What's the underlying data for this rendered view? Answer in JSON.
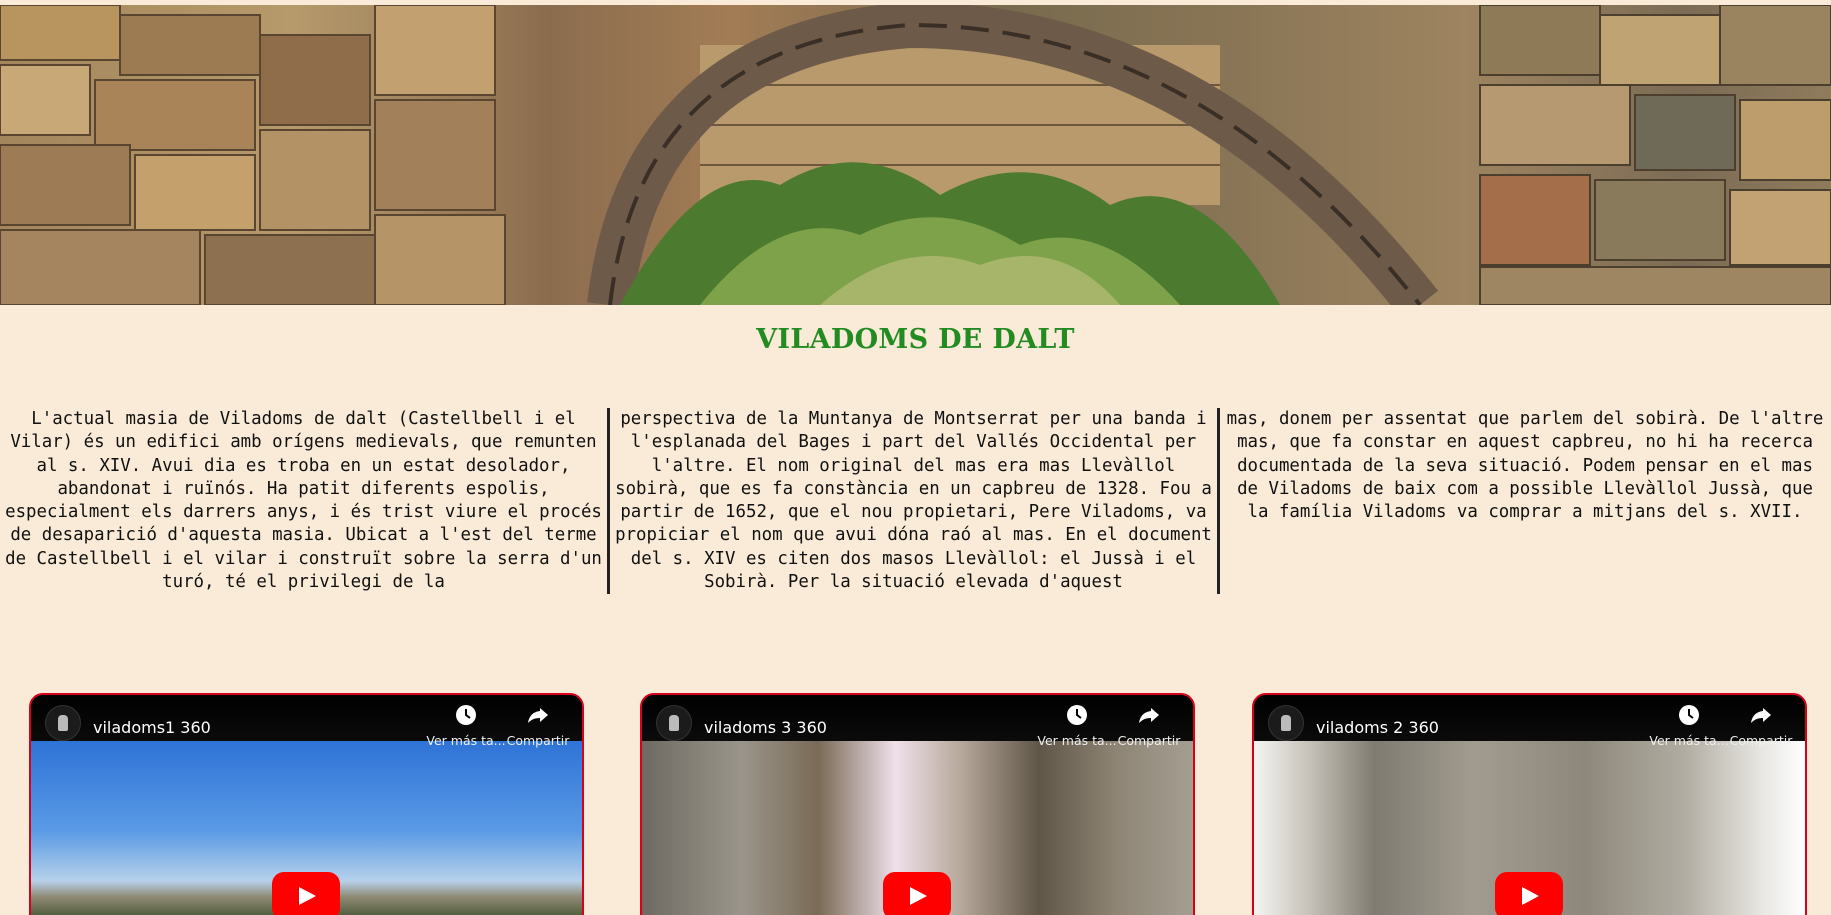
{
  "banner": {
    "image_alt": "Stone arch of the ruined masia Viladoms de dalt"
  },
  "page": {
    "title": "VILADOMS DE DALT"
  },
  "article": {
    "columns": [
      "L'actual masia de Viladoms de dalt (Castellbell i el Vilar) és un edifici amb orígens medievals, que remunten al s. XIV. Avui dia es troba en un estat desolador, abandonat i ruïnós. Ha patit diferents espolis, especialment els darrers anys, i és trist viure el procés de desaparició d'aquesta masia. Ubicat a l'est del terme de Castellbell i el vilar i construït sobre la serra d'un turó, té el privilegi de la",
      "perspectiva de la Muntanya de Montserrat per una banda i l'esplanada del Bages i part del Vallés Occidental per l'altre. El nom original del mas era mas Llevàllol sobirà, que es fa constància en un capbreu de 1328. Fou a partir de 1652, que el nou propietari, Pere Viladoms, va propiciar el nom que avui dóna raó al mas. En el document del s. XIV es citen dos masos Llevàllol: el Jussà i el Sobirà. Per la situació elevada d'aquest",
      "mas, donem per assentat que parlem del sobirà. De l'altre mas, que fa constar en aquest capbreu, no hi ha recerca documentada de la seva situació. Podem pensar en el mas de Viladoms de baix com a possible Llevàllol Jussà, que la família Viladoms va comprar a mitjans del s. XVII."
    ]
  },
  "videos": [
    {
      "title": "viladoms1 360",
      "watch_later": "Ver más ta...",
      "share": "Compartir"
    },
    {
      "title": "viladoms 3 360",
      "watch_later": "Ver más ta...",
      "share": "Compartir"
    },
    {
      "title": "viladoms 2 360",
      "watch_later": "Ver más ta...",
      "share": "Compartir"
    }
  ],
  "colors": {
    "background": "#f9ebd8",
    "title": "#228b22",
    "video_border": "#d8001a",
    "play_button": "#ff0000"
  }
}
